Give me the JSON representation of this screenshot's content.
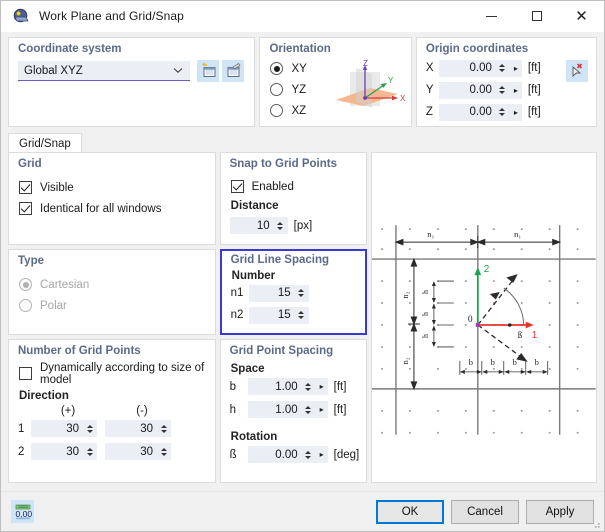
{
  "window": {
    "title": "Work Plane and Grid/Snap",
    "app_icon": "work-plane-icon",
    "minimize": "—",
    "maximize": "□",
    "close": "✕"
  },
  "coordinate_system": {
    "title": "Coordinate system",
    "selected": "Global XYZ",
    "chevron": "∨",
    "new_button_icon": "new-coordinate-system-icon",
    "edit_button_icon": "edit-coordinate-system-icon"
  },
  "orientation": {
    "title": "Orientation",
    "options": [
      {
        "label": "XY",
        "checked": true
      },
      {
        "label": "YZ",
        "checked": false
      },
      {
        "label": "XZ",
        "checked": false
      }
    ],
    "graphic": {
      "axis_x": "X",
      "axis_y": "Y",
      "axis_z": "Z",
      "color_x": "#d93b3b",
      "color_y": "#2f9e44",
      "color_z": "#6a3fb5",
      "plane_color": "#f2b48a"
    }
  },
  "origin_coordinates": {
    "title": "Origin coordinates",
    "pick_button_icon": "pick-point-icon",
    "rows": [
      {
        "axis": "X",
        "value": "0.00",
        "unit": "[ft]"
      },
      {
        "axis": "Y",
        "value": "0.00",
        "unit": "[ft]"
      },
      {
        "axis": "Z",
        "value": "0.00",
        "unit": "[ft]"
      }
    ]
  },
  "tabs": [
    {
      "label": "Grid/Snap",
      "active": true
    }
  ],
  "grid": {
    "title": "Grid",
    "visible": {
      "label": "Visible",
      "checked": true
    },
    "identical": {
      "label": "Identical for all windows",
      "checked": true
    }
  },
  "type": {
    "title": "Type",
    "options": [
      {
        "label": "Cartesian",
        "checked": true,
        "disabled": true
      },
      {
        "label": "Polar",
        "checked": false,
        "disabled": true
      }
    ]
  },
  "number_of_grid_points": {
    "title": "Number of Grid Points",
    "dynamic": {
      "label": "Dynamically according to size of model",
      "checked": false
    },
    "direction_label": "Direction",
    "col_plus": "(+)",
    "col_minus": "(-)",
    "rows": [
      {
        "index": "1",
        "plus": "30",
        "minus": "30"
      },
      {
        "index": "2",
        "plus": "30",
        "minus": "30"
      }
    ]
  },
  "snap_to_grid_points": {
    "title": "Snap to Grid Points",
    "enabled": {
      "label": "Enabled",
      "checked": true
    },
    "distance_label": "Distance",
    "distance_value": "10",
    "distance_unit": "[px]"
  },
  "grid_line_spacing": {
    "title": "Grid Line Spacing",
    "highlighted": true,
    "highlight_color": "#3a3ad0",
    "number_label": "Number",
    "rows": [
      {
        "key": "n1",
        "value": "15"
      },
      {
        "key": "n2",
        "value": "15"
      }
    ]
  },
  "grid_point_spacing": {
    "title": "Grid Point Spacing",
    "space_label": "Space",
    "rows": [
      {
        "key": "b",
        "value": "1.00",
        "unit": "[ft]"
      },
      {
        "key": "h",
        "value": "1.00",
        "unit": "[ft]"
      }
    ],
    "rotation_label": "Rotation",
    "rotation": {
      "key": "ß",
      "value": "0.00",
      "unit": "[deg]"
    }
  },
  "diagram": {
    "name": "grid-spacing-diagram",
    "labels": {
      "origin": "0",
      "axis_1": "1",
      "axis_2": "2",
      "angle": "ß",
      "n1": "n₁",
      "n2": "n₂",
      "b": "b",
      "h": "h"
    },
    "colors": {
      "axis_1": "#e8322a",
      "axis_2": "#1aa34a",
      "grid_line": "#6e6e6e",
      "grid_point": "#808080"
    }
  },
  "footer": {
    "settings_icon": "units-decimal-places-icon",
    "buttons": [
      {
        "label": "OK",
        "primary": true
      },
      {
        "label": "Cancel",
        "primary": false
      },
      {
        "label": "Apply",
        "primary": false
      }
    ]
  }
}
